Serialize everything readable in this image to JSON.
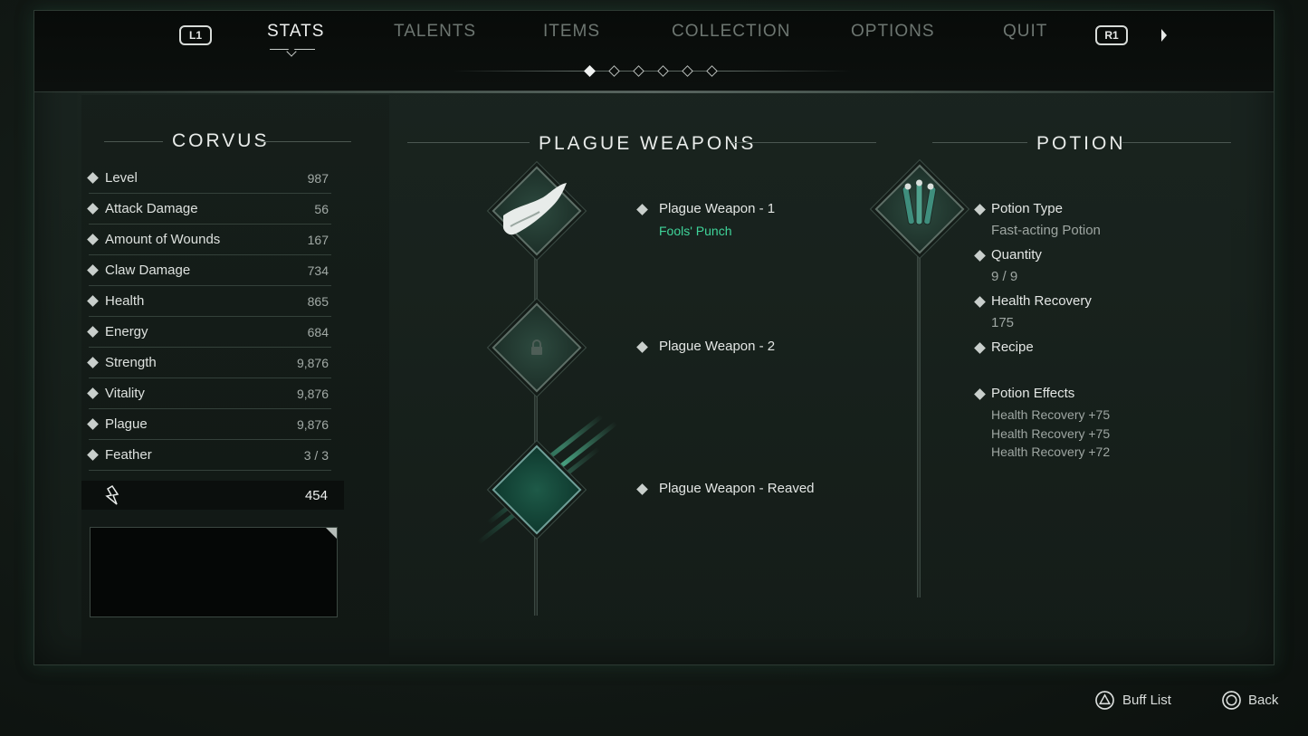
{
  "nav": {
    "left_button": "L1",
    "right_button": "R1",
    "tabs": [
      "STATS",
      "TALENTS",
      "ITEMS",
      "COLLECTION",
      "OPTIONS",
      "QUIT"
    ],
    "active_tab": "STATS",
    "page_count": 6,
    "active_page": 1
  },
  "character": {
    "name": "CORVUS",
    "stats": [
      {
        "label": "Level",
        "value": "987"
      },
      {
        "label": "Attack Damage",
        "value": "56"
      },
      {
        "label": "Amount of Wounds",
        "value": "167"
      },
      {
        "label": "Claw Damage",
        "value": "734"
      },
      {
        "label": "Health",
        "value": "865"
      },
      {
        "label": "Energy",
        "value": "684"
      },
      {
        "label": "Strength",
        "value": "9,876"
      },
      {
        "label": "Vitality",
        "value": "9,876"
      },
      {
        "label": "Plague",
        "value": "9,876"
      },
      {
        "label": "Feather",
        "value": "3 / 3"
      }
    ],
    "currency": "454"
  },
  "plague_weapons": {
    "title": "PLAGUE WEAPONS",
    "slots": [
      {
        "label": "Plague Weapon - 1",
        "equipped": "Fools' Punch"
      },
      {
        "label": "Plague Weapon - 2",
        "equipped": ""
      },
      {
        "label": "Plague Weapon - Reaved",
        "equipped": ""
      }
    ]
  },
  "potion": {
    "title": "POTION",
    "type_label": "Potion Type",
    "type_value": "Fast-acting Potion",
    "quantity_label": "Quantity",
    "quantity_value": "9 / 9",
    "recovery_label": "Health Recovery",
    "recovery_value": "175",
    "recipe_label": "Recipe",
    "effects_label": "Potion Effects",
    "effects": [
      "Health Recovery +75",
      "Health Recovery +75",
      "Health Recovery +72"
    ]
  },
  "footer": {
    "buff_list": "Buff List",
    "back": "Back"
  },
  "colors": {
    "accent_green": "#3fd49a",
    "background": "#141c18"
  }
}
